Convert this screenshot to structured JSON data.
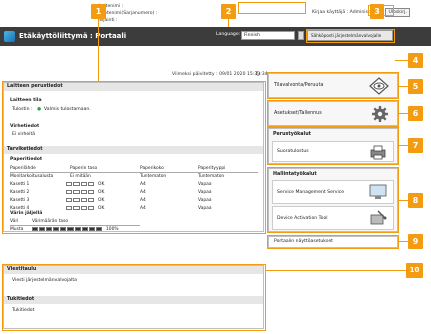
{
  "header_info": {
    "device_name": "Laitenimi :",
    "product_name": "Tuotenimi(Sarjanumero) :",
    "location": "Sijainti :",
    "login_user": "Kirjaa käyttäjä :",
    "user_name": "Administrator",
    "logout_label": "Uloskirj."
  },
  "titlebar": {
    "title": "Etäkäyttöliittymä : Portaali",
    "language_label": "Language:",
    "language_value": "Finnish",
    "mail_button": "Sähköposti järjestelmänvalvojalle"
  },
  "status": {
    "updated_label": "Viimeksi päivitetty : 09/01 2020 15:33:34"
  },
  "basic_info": {
    "header": "Laitteen perustiedot",
    "device_status_label": "Laitteen tila",
    "printer_label": "Tulostin :",
    "printer_status": "Valmis tulostamaan.",
    "error_label": "Virhetiedot",
    "error_value": "Ei virheitä"
  },
  "supplies": {
    "header": "Tarviketiedot",
    "paper_label": "Paperitiedot",
    "columns": [
      "Paperilähde",
      "Paperin taso",
      "Paperikoko",
      "Paperityyppi"
    ],
    "rows": [
      {
        "source": "Monitarkoitusalusta",
        "level": "Ei mitään",
        "size": "Tuntematon",
        "type": "Tuntematon"
      },
      {
        "source": "Kasetti 1",
        "level": "OK",
        "size": "A4",
        "type": "Vapaa"
      },
      {
        "source": "Kasetti 2",
        "level": "OK",
        "size": "A4",
        "type": "Vapaa"
      },
      {
        "source": "Kasetti 3",
        "level": "OK",
        "size": "A4",
        "type": "Vapaa"
      },
      {
        "source": "Kasetti 4",
        "level": "OK",
        "size": "A4",
        "type": "Vapaa"
      }
    ],
    "ink_label": "Värin jäljellä",
    "ink_columns": [
      "Väri",
      "Värimäärän taso"
    ],
    "ink_row": {
      "color": "Musta",
      "level": "100%"
    }
  },
  "messages": {
    "admin_header": "Viestitaulu",
    "admin_message": "Viesti järjestelmänvalvojalta",
    "support_header": "Tukitiedot",
    "support_value": "Tukitiedot"
  },
  "cards": {
    "status_monitor": "Tilavalvonta/Peruuta",
    "settings": "Asetukset/Tallennus",
    "print_header": "Perustyökalut",
    "direct_print": "Suoratulostus",
    "mgmt_header": "Hallintatyökalut",
    "sms": "Service Management Service",
    "dat": "Device Activation Tool",
    "portal_settings": "Portaalin näyttöasetukset"
  },
  "callouts": [
    "1",
    "2",
    "3",
    "4",
    "5",
    "6",
    "7",
    "8",
    "9",
    "10"
  ],
  "colors": {
    "accent": "#f39c12",
    "titlebar": "#3c3c3c",
    "status_ok": "#2ea44f"
  }
}
